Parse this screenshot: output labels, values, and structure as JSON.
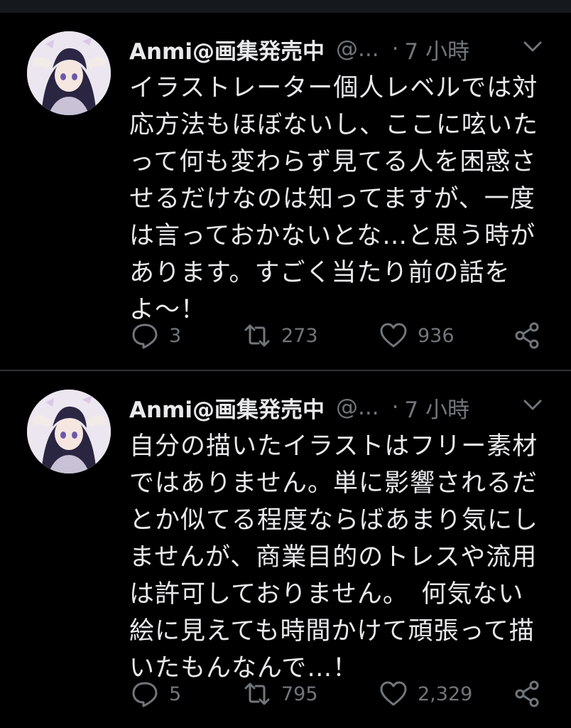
{
  "tweets": [
    {
      "author_name": "Anmi@画集発売中",
      "handle": "@...",
      "separator": "·",
      "time": "7 小時",
      "lines": [
        "イラストレーター個人レベルでは対",
        "応方法もほぼないし、ここに呟いた",
        "って何も変わらず見てる人を困惑さ",
        "せるだけなのは知ってますが、一度",
        "は言っておかないとな…と思う時が",
        "あります。すごく当たり前の話を",
        "よ〜！"
      ],
      "replies": "3",
      "retweets": "273",
      "likes": "936"
    },
    {
      "author_name": "Anmi@画集発売中",
      "handle": "@...",
      "separator": "·",
      "time": "7 小時",
      "lines": [
        "自分の描いたイラストはフリー素材",
        "ではありません。単に影響されるだ",
        "とか似てる程度ならばあまり気にし",
        "ませんが、商業目的のトレスや流用",
        "は許可しておりません。　何気ない",
        "絵に見えても時間かけて頑張って描",
        "いたもんなんで…！"
      ],
      "replies": "5",
      "retweets": "795",
      "likes": "2,329"
    }
  ],
  "icons": {
    "reply": "speech-bubble-icon",
    "retweet": "retweet-icon",
    "like": "heart-icon",
    "share": "share-icon",
    "menu": "chevron-down-icon"
  },
  "colors": {
    "background": "#000000",
    "text": "#e7e9ea",
    "muted": "#71767b",
    "divider": "#2f3336"
  }
}
